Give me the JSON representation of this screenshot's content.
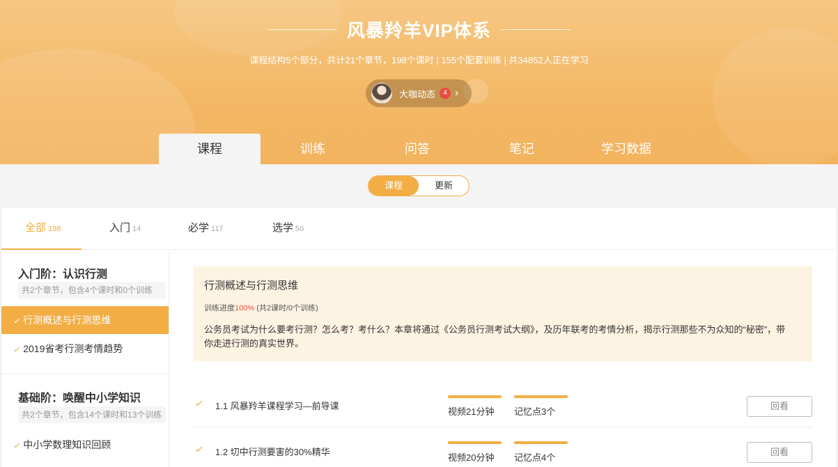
{
  "header": {
    "title": "风暴羚羊VIP体系",
    "subtitle": "课程结构5个部分，共计21个章节，198个课时 | 155个配套训练 | 共34852人正在学习",
    "dynamics": {
      "label": "大咖动态",
      "badge": "4"
    }
  },
  "main_tabs": [
    {
      "label": "课程",
      "active": true
    },
    {
      "label": "训练"
    },
    {
      "label": "问答"
    },
    {
      "label": "笔记"
    },
    {
      "label": "学习数据"
    }
  ],
  "toggle": {
    "left": "课程",
    "right": "更新",
    "active": "课程"
  },
  "filter_tabs": [
    {
      "label": "全部",
      "count": "198",
      "active": true
    },
    {
      "label": "入门",
      "count": "14"
    },
    {
      "label": "必学",
      "count": "117"
    },
    {
      "label": "选学",
      "count": "50"
    }
  ],
  "sidebar": {
    "stages": [
      {
        "title": "入门阶：认识行测",
        "desc": "共2个章节，包含4个课时和0个训练",
        "chapters": [
          {
            "label": "行测概述与行测思维",
            "active": true
          },
          {
            "label": "2019省考行测考情趋势"
          }
        ]
      },
      {
        "title": "基础阶：唤醒中小学知识",
        "desc": "共2个章节，包含14个课时和13个训练",
        "chapters": [
          {
            "label": "中小学数理知识回顾"
          }
        ]
      }
    ]
  },
  "chapter_detail": {
    "title": "行测概述与行测思维",
    "progress_prefix": "训练进度",
    "progress_pct": "100%",
    "progress_suffix": " (共2课时/0个训练)",
    "description": "公务员考试为什么要考行测？怎么考？考什么？本章将通过《公务员行测考试大纲》，及历年联考的考情分析，揭示行测那些不为众知的“秘密”，带你走进行测的真实世界。"
  },
  "lessons": [
    {
      "title": "1.1 风暴羚羊课程学习—前导课",
      "video": "视频21分钟",
      "memory": "记忆点3个",
      "button": "回看"
    },
    {
      "title": "1.2 切中行测要害的30%精华",
      "video": "视频20分钟",
      "memory": "记忆点4个",
      "button": "回看"
    }
  ],
  "colors": {
    "accent": "#f2ad44",
    "hero": "#f3b866",
    "badge": "#e84c3d"
  },
  "icons": {
    "check": "check-icon",
    "chevron": "chevron-right-icon"
  }
}
